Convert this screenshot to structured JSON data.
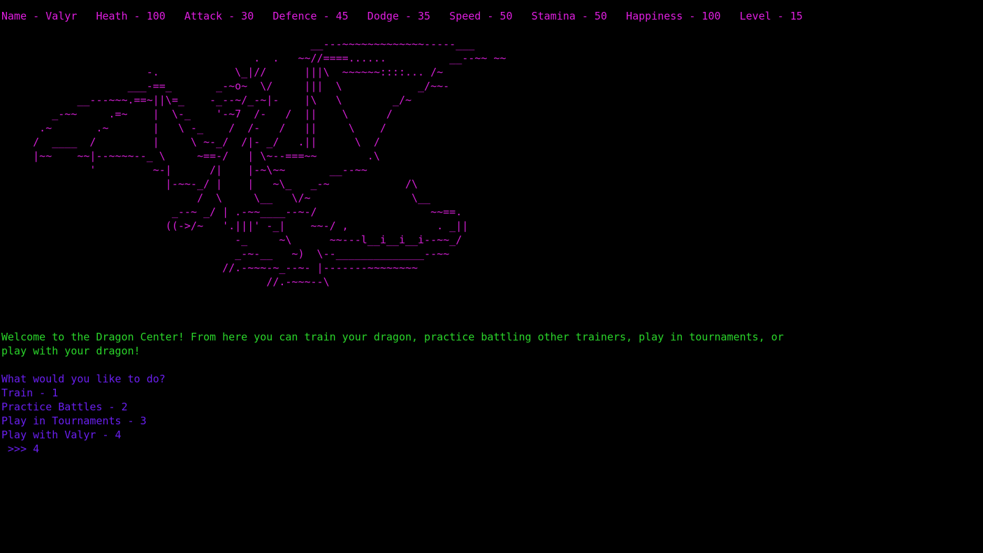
{
  "colors": {
    "background": "#000000",
    "stats": "#e01ee0",
    "art": "#d41fd4",
    "welcome": "#2ad52a",
    "menu": "#6a1ff0"
  },
  "stats_line": "Name - Valyr   Heath - 100   Attack - 30   Defence - 45   Dodge - 35   Speed - 50   Stamina - 50   Happiness - 100   Level - 15",
  "dragon_art": "                                                 __---~~~~~~~~~~~~~-----___\n                                        .  .   ~~//====......          __--~~ ~~\n                       -.            \\_|//      |||\\  ~~~~~~::::... /~\n                    ___-==_       _-~o~  \\/     |||  \\            _/~~-\n            __---~~~.==~||\\=_    -_--~/_-~|-    |\\   \\        _/~\n        _-~~     .=~    |  \\-_    '-~7  /-   /  ||    \\      /\n      .~       .~       |   \\ -_    /  /-   /   ||     \\    /\n     /  ____  /         |     \\ ~-_/  /|- _/   .||      \\  /\n     |~~    ~~|--~~~~--_ \\     ~==-/   | \\~--===~~        .\\\n              '         ~-|      /|    |-~\\~~       __--~~\n                          |-~~-_/ |    |   ~\\_   _-~            /\\\n                               /  \\     \\__   \\/~                \\__\n                           _--~ _/ | .-~~____--~-/                  ~~==.\n                          ((->/~   '.|||' -_|    ~~-/ ,              . _||\n                                     -_     ~\\      ~~---l__i__i__i--~~_/\n                                     _-~-__   ~)  \\--______________--~~\n                                   //.-~~~-~_--~- |-------~~~~~~~~\n                                          //.-~~~--\\",
  "welcome_line1": "Welcome to the Dragon Center! From here you can train your dragon, practice battling other trainers, play in tournaments, or",
  "welcome_line2": "play with your dragon!",
  "menu": {
    "question": "What would you like to do?",
    "options": [
      "Train - 1",
      "Practice Battles - 2",
      "Play in Tournaments - 3",
      "Play with Valyr - 4"
    ],
    "prompt": " >>> 4"
  }
}
